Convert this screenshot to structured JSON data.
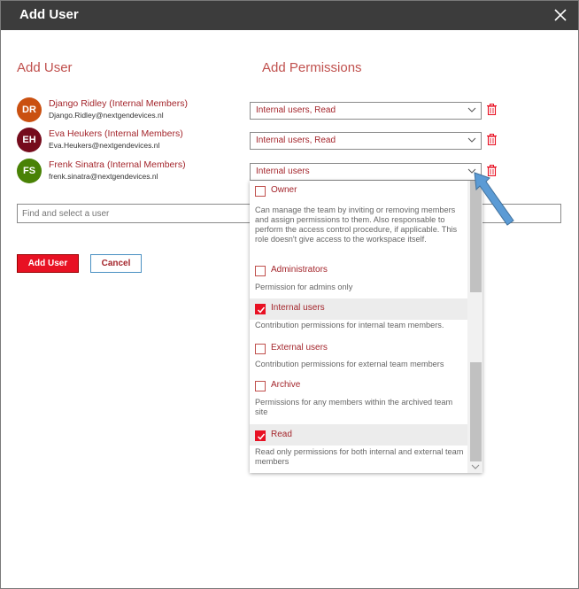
{
  "dialog": {
    "title": "Add User",
    "close_icon": "close-icon"
  },
  "sections": {
    "add_user": "Add User",
    "add_permissions": "Add Permissions"
  },
  "users": [
    {
      "initials": "DR",
      "name": "Django Ridley (Internal Members)",
      "email": "Django.Ridley@nextgendevices.nl",
      "color": "#ca5010",
      "permissions": "Internal users, Read"
    },
    {
      "initials": "EH",
      "name": "Eva Heukers (Internal Members)",
      "email": "Eva.Heukers@nextgendevices.nl",
      "color": "#750b1c",
      "permissions": "Internal users, Read"
    },
    {
      "initials": "FS",
      "name": "Frenk Sinatra (Internal Members)",
      "email": "frenk.sinatra@nextgendevices.nl",
      "color": "#498205",
      "permissions": "Internal users"
    }
  ],
  "find_input": {
    "placeholder": "Find and select a user"
  },
  "buttons": {
    "add_user": "Add User",
    "cancel": "Cancel"
  },
  "dropdown_options": [
    {
      "label": "Owner",
      "checked": false,
      "description": "Can manage the team by inviting or removing members and assign permissions to them. Also responsable to perform the access control procedure, if applicable. This role doesn't give access to the workspace itself."
    },
    {
      "label": "Administrators",
      "checked": false,
      "description": "Permission for admins only"
    },
    {
      "label": "Internal users",
      "checked": true,
      "description": "Contribution permissions for internal team members."
    },
    {
      "label": "External users",
      "checked": false,
      "description": "Contribution permissions for external team members"
    },
    {
      "label": "Archive",
      "checked": false,
      "description": "Permissions for any members within the archived team site"
    },
    {
      "label": "Read",
      "checked": true,
      "description": "Read only permissions for both internal and external team members"
    }
  ],
  "colors": {
    "accent_red": "#e81123",
    "text_red": "#a4262c",
    "titlebar": "#3c3c3c",
    "annotation_arrow": "#5b9bd5"
  }
}
